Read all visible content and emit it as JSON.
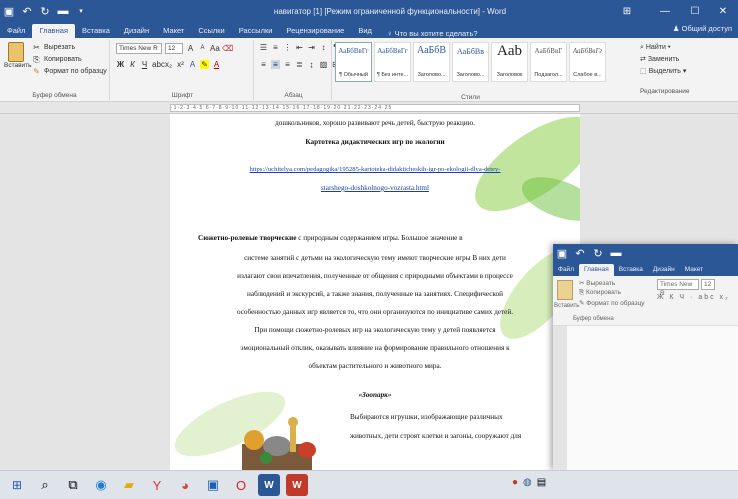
{
  "window": {
    "title": "навигатор [1] [Режим ограниченной функциональности] - Word",
    "tabs": [
      "Файл",
      "Главная",
      "Вставка",
      "Дизайн",
      "Макет",
      "Ссылки",
      "Рассылки",
      "Рецензирование",
      "Вид"
    ],
    "active_tab": "Главная",
    "tell_me": "Что вы хотите сделать?",
    "share": "Общий доступ"
  },
  "ribbon": {
    "clipboard": {
      "paste": "Вставить",
      "cut": "Вырезать",
      "copy": "Копировать",
      "format_painter": "Формат по образцу",
      "label": "Буфер обмена"
    },
    "font": {
      "name": "Times New R",
      "size": "12",
      "label": "Шрифт"
    },
    "paragraph": {
      "label": "Абзац"
    },
    "styles": {
      "label": "Стили",
      "items": [
        {
          "preview": "АаБбВвГг",
          "name": "¶ Обычный"
        },
        {
          "preview": "АаБбВвГг",
          "name": "¶ Без инте..."
        },
        {
          "preview": "АаБбВ",
          "name": "Заголово..."
        },
        {
          "preview": "АаБбВв",
          "name": "Заголово..."
        },
        {
          "preview": "Aab",
          "name": "Заголовок"
        },
        {
          "preview": "АаБбВвГ",
          "name": "Подзагол..."
        },
        {
          "preview": "АаБбВвГг",
          "name": "Слабое в..."
        }
      ]
    },
    "editing": {
      "find": "Найти",
      "replace": "Заменить",
      "select": "Выделить",
      "label": "Редактирование"
    }
  },
  "document": {
    "lines": [
      {
        "text": "дошкольников, хорошо развивают речь детей, быструю реакцию.",
        "style": ""
      },
      {
        "text": "Картотека дидактических игр по экологии",
        "style": "bold"
      },
      {
        "text": "https://uchitelya.com/pedagogika/195285-kartoteka-didakticheskih-igr-po-ekologii-dlya-detey-",
        "style": "link"
      },
      {
        "text": "starshego-doshkolnogo-vozrasta.html",
        "style": "link"
      },
      {
        "text": "Сюжетно-ролевые творческие с природным содержанием игры. Большое значение в",
        "style": ""
      },
      {
        "text": "системе занятий с детьми на экологическую тему имеют творческие игры В них дети",
        "style": ""
      },
      {
        "text": "излагают свои впечатления, полученные от общения с природными объектами в процессе",
        "style": ""
      },
      {
        "text": "наблюдений и экскурсий, а также знания, полученные на занятиях. Специфической",
        "style": ""
      },
      {
        "text": "особенностью данных игр является то, что они организуются по инициативе самих детей.",
        "style": ""
      },
      {
        "text": "При помощи сюжетно-ролевых игр на экологическую тему у детей появляется",
        "style": ""
      },
      {
        "text": "эмоциональный отклик, оказывать влияние на формирование правильного отношения к",
        "style": ""
      },
      {
        "text": "объектам растительного и животного мира.",
        "style": ""
      },
      {
        "text": "«Зоопарк»",
        "style": "ital"
      },
      {
        "text": "Выбираются игрушки, изображающие различных",
        "style": ""
      },
      {
        "text": "животных, дети строят клетки и загоны, сооружают для",
        "style": ""
      }
    ]
  },
  "second_window": {
    "tabs": [
      "Файл",
      "Главная",
      "Вставка",
      "Дизайн",
      "Макет"
    ],
    "active_tab": "Главная",
    "cut": "Вырезать",
    "copy": "Копировать",
    "format_painter": "Формат по образцу",
    "paste": "Вставить",
    "clipboard_label": "Буфер обмена",
    "font_name": "Times New R",
    "font_size": "12"
  },
  "colors": {
    "word_blue": "#2b5797",
    "ribbon_bg": "#f3f3f3",
    "link": "#1a3fb0"
  },
  "taskbar": {
    "icons": [
      "windows-start-icon",
      "search-icon",
      "task-view-icon",
      "edge-browser-icon",
      "file-explorer-icon",
      "yandex-browser-icon",
      "chrome-icon",
      "mail-icon",
      "opera-icon",
      "word-icon",
      "word-icon-2"
    ]
  }
}
